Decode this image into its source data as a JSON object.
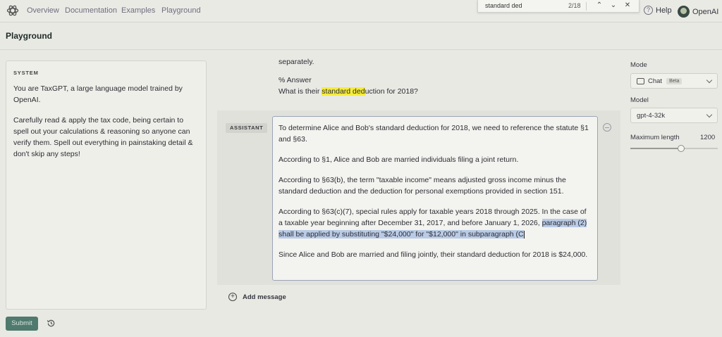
{
  "nav": {
    "links": [
      "Overview",
      "Documentation",
      "Examples",
      "Playground"
    ],
    "help": "Help",
    "org": "OpenAI"
  },
  "find": {
    "query": "standard ded",
    "count": "2/18"
  },
  "page": {
    "title": "Playground"
  },
  "system": {
    "label": "SYSTEM",
    "paragraphs": [
      "You are TaxGPT, a large language model trained by OpenAI.",
      "Carefully read & apply the tax code, being certain to spell out your calculations & reasoning so anyone can verify them. Spell out everything in painstaking detail & don't skip any steps!"
    ]
  },
  "previous": {
    "line1": "separately.",
    "line2": "% Answer",
    "q_before": "What is their ",
    "q_highlight": "standard ded",
    "q_after": "uction for 2018?"
  },
  "assistant": {
    "label": "ASSISTANT",
    "p1": "To determine Alice and Bob's standard deduction for 2018, we need to reference the statute §1 and §63.",
    "p2": "According to §1, Alice and Bob are married individuals filing a joint return.",
    "p3": "According to §63(b), the term \"taxable income\" means adjusted gross income minus the standard deduction and the deduction for personal exemptions provided in section 151.",
    "p4_before": "According to §63(c)(7), special rules apply for taxable years 2018 through 2025. In the case of a taxable year beginning after December 31, 2017, and before January 1, 2026, ",
    "p4_selected": "paragraph (2) shall be applied by substituting \"$24,000\" for \"$12,000\" in subparagraph (C",
    "p5": "Since Alice and Bob are married and filing jointly, their standard deduction for 2018 is $24,000."
  },
  "add_message": "Add message",
  "submit": "Submit",
  "settings": {
    "mode_label": "Mode",
    "mode_value": "Chat",
    "mode_badge": "Beta",
    "model_label": "Model",
    "model_value": "gpt-4-32k",
    "maxlen_label": "Maximum length",
    "maxlen_value": "1200",
    "maxlen_fraction": 0.58
  },
  "colors": {
    "submit": "#4f7a6d",
    "find_highlight": "#f5ec3c",
    "selection": "#b9cbe6"
  }
}
